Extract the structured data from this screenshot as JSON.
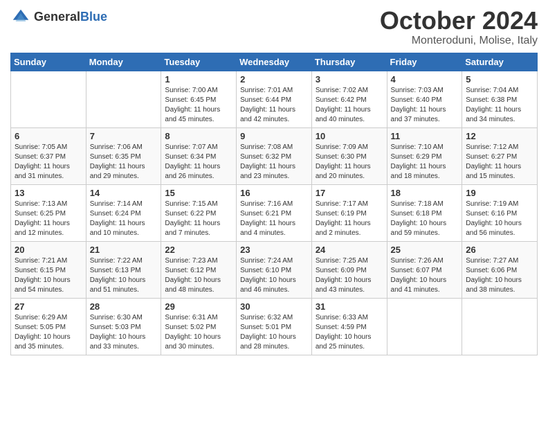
{
  "header": {
    "logo_general": "General",
    "logo_blue": "Blue",
    "month_title": "October 2024",
    "location": "Monteroduni, Molise, Italy"
  },
  "weekdays": [
    "Sunday",
    "Monday",
    "Tuesday",
    "Wednesday",
    "Thursday",
    "Friday",
    "Saturday"
  ],
  "weeks": [
    [
      {
        "day": "",
        "sunrise": "",
        "sunset": "",
        "daylight": ""
      },
      {
        "day": "",
        "sunrise": "",
        "sunset": "",
        "daylight": ""
      },
      {
        "day": "1",
        "sunrise": "Sunrise: 7:00 AM",
        "sunset": "Sunset: 6:45 PM",
        "daylight": "Daylight: 11 hours and 45 minutes."
      },
      {
        "day": "2",
        "sunrise": "Sunrise: 7:01 AM",
        "sunset": "Sunset: 6:44 PM",
        "daylight": "Daylight: 11 hours and 42 minutes."
      },
      {
        "day": "3",
        "sunrise": "Sunrise: 7:02 AM",
        "sunset": "Sunset: 6:42 PM",
        "daylight": "Daylight: 11 hours and 40 minutes."
      },
      {
        "day": "4",
        "sunrise": "Sunrise: 7:03 AM",
        "sunset": "Sunset: 6:40 PM",
        "daylight": "Daylight: 11 hours and 37 minutes."
      },
      {
        "day": "5",
        "sunrise": "Sunrise: 7:04 AM",
        "sunset": "Sunset: 6:38 PM",
        "daylight": "Daylight: 11 hours and 34 minutes."
      }
    ],
    [
      {
        "day": "6",
        "sunrise": "Sunrise: 7:05 AM",
        "sunset": "Sunset: 6:37 PM",
        "daylight": "Daylight: 11 hours and 31 minutes."
      },
      {
        "day": "7",
        "sunrise": "Sunrise: 7:06 AM",
        "sunset": "Sunset: 6:35 PM",
        "daylight": "Daylight: 11 hours and 29 minutes."
      },
      {
        "day": "8",
        "sunrise": "Sunrise: 7:07 AM",
        "sunset": "Sunset: 6:34 PM",
        "daylight": "Daylight: 11 hours and 26 minutes."
      },
      {
        "day": "9",
        "sunrise": "Sunrise: 7:08 AM",
        "sunset": "Sunset: 6:32 PM",
        "daylight": "Daylight: 11 hours and 23 minutes."
      },
      {
        "day": "10",
        "sunrise": "Sunrise: 7:09 AM",
        "sunset": "Sunset: 6:30 PM",
        "daylight": "Daylight: 11 hours and 20 minutes."
      },
      {
        "day": "11",
        "sunrise": "Sunrise: 7:10 AM",
        "sunset": "Sunset: 6:29 PM",
        "daylight": "Daylight: 11 hours and 18 minutes."
      },
      {
        "day": "12",
        "sunrise": "Sunrise: 7:12 AM",
        "sunset": "Sunset: 6:27 PM",
        "daylight": "Daylight: 11 hours and 15 minutes."
      }
    ],
    [
      {
        "day": "13",
        "sunrise": "Sunrise: 7:13 AM",
        "sunset": "Sunset: 6:25 PM",
        "daylight": "Daylight: 11 hours and 12 minutes."
      },
      {
        "day": "14",
        "sunrise": "Sunrise: 7:14 AM",
        "sunset": "Sunset: 6:24 PM",
        "daylight": "Daylight: 11 hours and 10 minutes."
      },
      {
        "day": "15",
        "sunrise": "Sunrise: 7:15 AM",
        "sunset": "Sunset: 6:22 PM",
        "daylight": "Daylight: 11 hours and 7 minutes."
      },
      {
        "day": "16",
        "sunrise": "Sunrise: 7:16 AM",
        "sunset": "Sunset: 6:21 PM",
        "daylight": "Daylight: 11 hours and 4 minutes."
      },
      {
        "day": "17",
        "sunrise": "Sunrise: 7:17 AM",
        "sunset": "Sunset: 6:19 PM",
        "daylight": "Daylight: 11 hours and 2 minutes."
      },
      {
        "day": "18",
        "sunrise": "Sunrise: 7:18 AM",
        "sunset": "Sunset: 6:18 PM",
        "daylight": "Daylight: 10 hours and 59 minutes."
      },
      {
        "day": "19",
        "sunrise": "Sunrise: 7:19 AM",
        "sunset": "Sunset: 6:16 PM",
        "daylight": "Daylight: 10 hours and 56 minutes."
      }
    ],
    [
      {
        "day": "20",
        "sunrise": "Sunrise: 7:21 AM",
        "sunset": "Sunset: 6:15 PM",
        "daylight": "Daylight: 10 hours and 54 minutes."
      },
      {
        "day": "21",
        "sunrise": "Sunrise: 7:22 AM",
        "sunset": "Sunset: 6:13 PM",
        "daylight": "Daylight: 10 hours and 51 minutes."
      },
      {
        "day": "22",
        "sunrise": "Sunrise: 7:23 AM",
        "sunset": "Sunset: 6:12 PM",
        "daylight": "Daylight: 10 hours and 48 minutes."
      },
      {
        "day": "23",
        "sunrise": "Sunrise: 7:24 AM",
        "sunset": "Sunset: 6:10 PM",
        "daylight": "Daylight: 10 hours and 46 minutes."
      },
      {
        "day": "24",
        "sunrise": "Sunrise: 7:25 AM",
        "sunset": "Sunset: 6:09 PM",
        "daylight": "Daylight: 10 hours and 43 minutes."
      },
      {
        "day": "25",
        "sunrise": "Sunrise: 7:26 AM",
        "sunset": "Sunset: 6:07 PM",
        "daylight": "Daylight: 10 hours and 41 minutes."
      },
      {
        "day": "26",
        "sunrise": "Sunrise: 7:27 AM",
        "sunset": "Sunset: 6:06 PM",
        "daylight": "Daylight: 10 hours and 38 minutes."
      }
    ],
    [
      {
        "day": "27",
        "sunrise": "Sunrise: 6:29 AM",
        "sunset": "Sunset: 5:05 PM",
        "daylight": "Daylight: 10 hours and 35 minutes."
      },
      {
        "day": "28",
        "sunrise": "Sunrise: 6:30 AM",
        "sunset": "Sunset: 5:03 PM",
        "daylight": "Daylight: 10 hours and 33 minutes."
      },
      {
        "day": "29",
        "sunrise": "Sunrise: 6:31 AM",
        "sunset": "Sunset: 5:02 PM",
        "daylight": "Daylight: 10 hours and 30 minutes."
      },
      {
        "day": "30",
        "sunrise": "Sunrise: 6:32 AM",
        "sunset": "Sunset: 5:01 PM",
        "daylight": "Daylight: 10 hours and 28 minutes."
      },
      {
        "day": "31",
        "sunrise": "Sunrise: 6:33 AM",
        "sunset": "Sunset: 4:59 PM",
        "daylight": "Daylight: 10 hours and 25 minutes."
      },
      {
        "day": "",
        "sunrise": "",
        "sunset": "",
        "daylight": ""
      },
      {
        "day": "",
        "sunrise": "",
        "sunset": "",
        "daylight": ""
      }
    ]
  ]
}
